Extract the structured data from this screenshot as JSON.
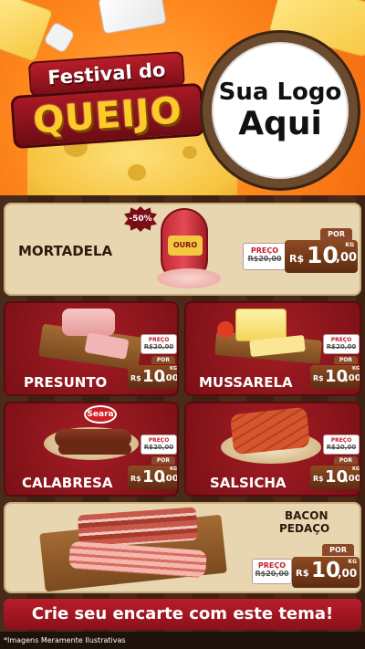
{
  "header": {
    "title_top": "Festival do",
    "title_main": "QUEIJO",
    "logo_line1": "Sua Logo",
    "logo_line2": "Aqui"
  },
  "featured": {
    "name": "MORTADELA",
    "discount": "-50%",
    "package_label": "OURO",
    "por_label": "POR",
    "preco_label": "PREÇO",
    "old_price": "R$20,00",
    "currency": "R$",
    "price_int": "10",
    "price_dec": ",00",
    "unit": "KG"
  },
  "products": [
    {
      "name": "PRESUNTO",
      "preco_label": "PREÇO",
      "old_price": "R$20,00",
      "por_label": "POR",
      "currency": "R$",
      "price_int": "10",
      "price_dec": ",00",
      "unit": "KG"
    },
    {
      "name": "MUSSARELA",
      "preco_label": "PREÇO",
      "old_price": "R$20,00",
      "por_label": "POR",
      "currency": "R$",
      "price_int": "10",
      "price_dec": ",00",
      "unit": "KG"
    },
    {
      "name": "CALABRESA",
      "brand": "Seara",
      "preco_label": "PREÇO",
      "old_price": "R$20,00",
      "por_label": "POR",
      "currency": "R$",
      "price_int": "10",
      "price_dec": ",00",
      "unit": "KG"
    },
    {
      "name": "SALSICHA",
      "preco_label": "PREÇO",
      "old_price": "R$20,00",
      "por_label": "POR",
      "currency": "R$",
      "price_int": "10",
      "price_dec": ",00",
      "unit": "KG"
    }
  ],
  "bacon": {
    "name_line1": "BACON",
    "name_line2": "PEDAÇO",
    "preco_label": "PREÇO",
    "old_price": "R$20,00",
    "por_label": "POR",
    "currency": "R$",
    "price_int": "10",
    "price_dec": ",00",
    "unit": "KG"
  },
  "cta": "Crie seu encarte com este tema!",
  "footnote": "*Imagens Meramente Ilustrativas",
  "colors": {
    "brand_red": "#8a1119",
    "cheese_yellow": "#ffc928",
    "header_orange": "#ff8a1f",
    "price_brown": "#5e2c12"
  }
}
